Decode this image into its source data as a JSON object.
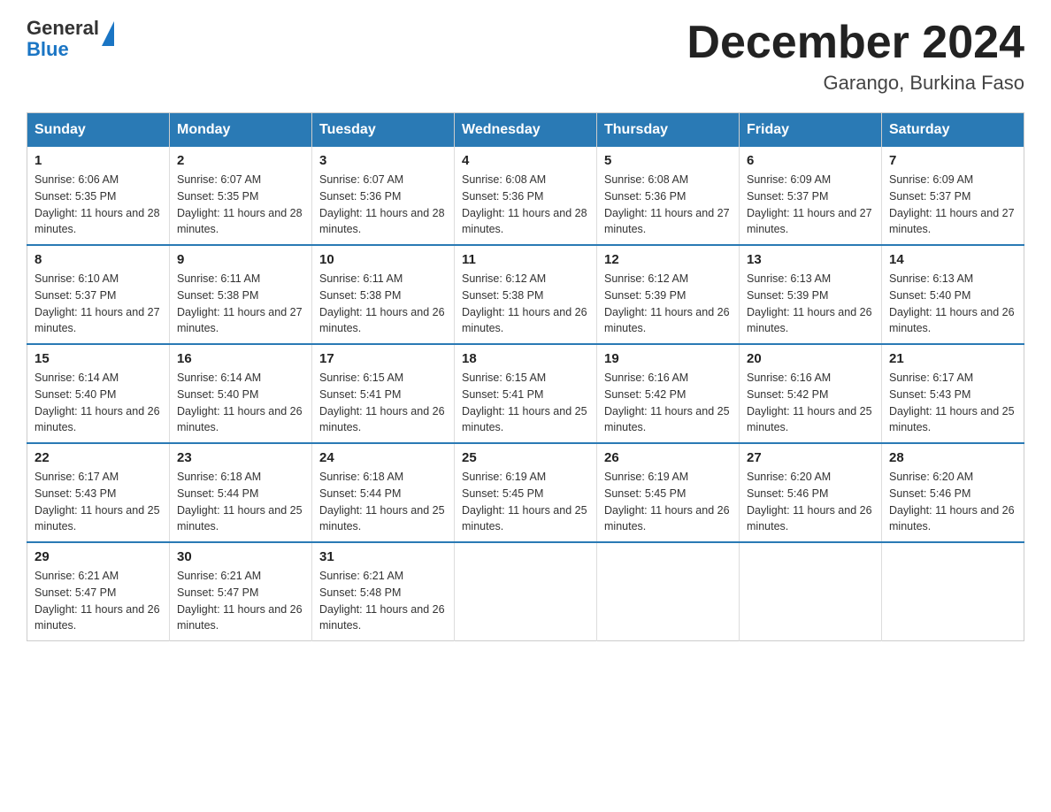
{
  "header": {
    "logo_general": "General",
    "logo_blue": "Blue",
    "month_title": "December 2024",
    "location": "Garango, Burkina Faso"
  },
  "days_of_week": [
    "Sunday",
    "Monday",
    "Tuesday",
    "Wednesday",
    "Thursday",
    "Friday",
    "Saturday"
  ],
  "weeks": [
    [
      {
        "day": "1",
        "sunrise": "6:06 AM",
        "sunset": "5:35 PM",
        "daylight": "11 hours and 28 minutes."
      },
      {
        "day": "2",
        "sunrise": "6:07 AM",
        "sunset": "5:35 PM",
        "daylight": "11 hours and 28 minutes."
      },
      {
        "day": "3",
        "sunrise": "6:07 AM",
        "sunset": "5:36 PM",
        "daylight": "11 hours and 28 minutes."
      },
      {
        "day": "4",
        "sunrise": "6:08 AM",
        "sunset": "5:36 PM",
        "daylight": "11 hours and 28 minutes."
      },
      {
        "day": "5",
        "sunrise": "6:08 AM",
        "sunset": "5:36 PM",
        "daylight": "11 hours and 27 minutes."
      },
      {
        "day": "6",
        "sunrise": "6:09 AM",
        "sunset": "5:37 PM",
        "daylight": "11 hours and 27 minutes."
      },
      {
        "day": "7",
        "sunrise": "6:09 AM",
        "sunset": "5:37 PM",
        "daylight": "11 hours and 27 minutes."
      }
    ],
    [
      {
        "day": "8",
        "sunrise": "6:10 AM",
        "sunset": "5:37 PM",
        "daylight": "11 hours and 27 minutes."
      },
      {
        "day": "9",
        "sunrise": "6:11 AM",
        "sunset": "5:38 PM",
        "daylight": "11 hours and 27 minutes."
      },
      {
        "day": "10",
        "sunrise": "6:11 AM",
        "sunset": "5:38 PM",
        "daylight": "11 hours and 26 minutes."
      },
      {
        "day": "11",
        "sunrise": "6:12 AM",
        "sunset": "5:38 PM",
        "daylight": "11 hours and 26 minutes."
      },
      {
        "day": "12",
        "sunrise": "6:12 AM",
        "sunset": "5:39 PM",
        "daylight": "11 hours and 26 minutes."
      },
      {
        "day": "13",
        "sunrise": "6:13 AM",
        "sunset": "5:39 PM",
        "daylight": "11 hours and 26 minutes."
      },
      {
        "day": "14",
        "sunrise": "6:13 AM",
        "sunset": "5:40 PM",
        "daylight": "11 hours and 26 minutes."
      }
    ],
    [
      {
        "day": "15",
        "sunrise": "6:14 AM",
        "sunset": "5:40 PM",
        "daylight": "11 hours and 26 minutes."
      },
      {
        "day": "16",
        "sunrise": "6:14 AM",
        "sunset": "5:40 PM",
        "daylight": "11 hours and 26 minutes."
      },
      {
        "day": "17",
        "sunrise": "6:15 AM",
        "sunset": "5:41 PM",
        "daylight": "11 hours and 26 minutes."
      },
      {
        "day": "18",
        "sunrise": "6:15 AM",
        "sunset": "5:41 PM",
        "daylight": "11 hours and 25 minutes."
      },
      {
        "day": "19",
        "sunrise": "6:16 AM",
        "sunset": "5:42 PM",
        "daylight": "11 hours and 25 minutes."
      },
      {
        "day": "20",
        "sunrise": "6:16 AM",
        "sunset": "5:42 PM",
        "daylight": "11 hours and 25 minutes."
      },
      {
        "day": "21",
        "sunrise": "6:17 AM",
        "sunset": "5:43 PM",
        "daylight": "11 hours and 25 minutes."
      }
    ],
    [
      {
        "day": "22",
        "sunrise": "6:17 AM",
        "sunset": "5:43 PM",
        "daylight": "11 hours and 25 minutes."
      },
      {
        "day": "23",
        "sunrise": "6:18 AM",
        "sunset": "5:44 PM",
        "daylight": "11 hours and 25 minutes."
      },
      {
        "day": "24",
        "sunrise": "6:18 AM",
        "sunset": "5:44 PM",
        "daylight": "11 hours and 25 minutes."
      },
      {
        "day": "25",
        "sunrise": "6:19 AM",
        "sunset": "5:45 PM",
        "daylight": "11 hours and 25 minutes."
      },
      {
        "day": "26",
        "sunrise": "6:19 AM",
        "sunset": "5:45 PM",
        "daylight": "11 hours and 26 minutes."
      },
      {
        "day": "27",
        "sunrise": "6:20 AM",
        "sunset": "5:46 PM",
        "daylight": "11 hours and 26 minutes."
      },
      {
        "day": "28",
        "sunrise": "6:20 AM",
        "sunset": "5:46 PM",
        "daylight": "11 hours and 26 minutes."
      }
    ],
    [
      {
        "day": "29",
        "sunrise": "6:21 AM",
        "sunset": "5:47 PM",
        "daylight": "11 hours and 26 minutes."
      },
      {
        "day": "30",
        "sunrise": "6:21 AM",
        "sunset": "5:47 PM",
        "daylight": "11 hours and 26 minutes."
      },
      {
        "day": "31",
        "sunrise": "6:21 AM",
        "sunset": "5:48 PM",
        "daylight": "11 hours and 26 minutes."
      },
      null,
      null,
      null,
      null
    ]
  ]
}
